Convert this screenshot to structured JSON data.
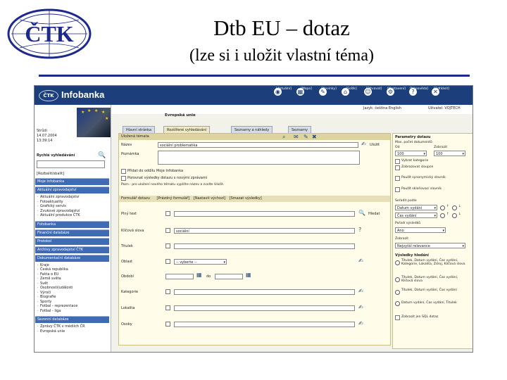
{
  "slide": {
    "logo": "ČTK",
    "title": "Dtb EU –  dotaz",
    "subtitle": "(lze si i uložit vlastní téma)"
  },
  "app": {
    "logo": "ČTK",
    "title": "Infobanka",
    "nav": [
      "[Aktuální]",
      "[Mapa]",
      "[Novinky]",
      "[Sošík]",
      "[Dítvavat]",
      "[Nastavení]",
      "[Nápověda]",
      "[Odhlásit]"
    ]
  },
  "left": {
    "info": [
      "Strůdi",
      "14.07.2004",
      "13:39:14"
    ],
    "quick_search_label": "Rychlé vyhledávání",
    "expand_label": "[Rozbalit/sbalit]",
    "menu": [
      {
        "title": "Moje Infobanka",
        "items": []
      },
      {
        "title": "Aktuální zpravodajství",
        "items": [
          "Aktuální zpravodajství",
          "Fotoaktuality",
          "Grafický servis",
          "Zvukové zpravodajství",
          "Aktuální produkce ČTK"
        ]
      },
      {
        "title": "Fotobanka",
        "items": []
      },
      {
        "title": "Finanční databáze",
        "items": []
      },
      {
        "title": "Protokol",
        "items": []
      },
      {
        "title": "Archivy zpravodajství ČTK",
        "items": []
      },
      {
        "title": "Dokumentační databáze",
        "items": [
          "Kraje",
          "Česká republika",
          "Fakta o EU",
          "Země světa",
          "Svět",
          "Osobnosti/události",
          "Výročí",
          "Biografie",
          "Sporty",
          "Fotbal - reprezentace",
          "Fotbal - liga"
        ]
      },
      {
        "title": "Sezonní databáze",
        "items": [
          "Zprávy ČTK v médiích ČR",
          "Evropská unie"
        ]
      }
    ]
  },
  "main": {
    "lang": "Jazyk: čeština   English",
    "user": "Uživatel: VOJTECH",
    "eu_title": "Evropská unie",
    "tabs": [
      "Hlavní stránka",
      "Rozšířené vyhledávání",
      "Seznamy a náhledy",
      "Seznamy"
    ],
    "query_title": "Uložená témata",
    "rows": {
      "nazev_label": "Název",
      "nazev_value": "sociální problematika",
      "save_label": "Uložit",
      "poznamka_label": "Poznámka",
      "checkbox1": "Přidat do oddílu Moje Infobanka",
      "checkbox2": "Porovnat výsledky dotazu s novými zprávami",
      "note": "Pozn.: pro uložení nového tématu vyplňte název a zvolte Uložit.",
      "section_label": "Formulář dotazu",
      "link_reset": "[Prázdný formulář]",
      "link_prev": "[Nastavit výchozí]",
      "link_hide": "[Smazat výsledky]",
      "plny_text": "Plný text",
      "klic_slova": "Klíčová slova",
      "klic_value": "sociální",
      "titulek": "Titulek",
      "oblast": "Oblast",
      "oblast_value": "-- vyberte --",
      "obdobi": "Období",
      "obdobi_do": "do",
      "kategorie": "Kategorie",
      "lokalita": "Lokalita",
      "osoby": "Osoby",
      "hledat": "Hledat"
    }
  },
  "right": {
    "title": "Parametry dotazu",
    "sub": "Max. počet dokumentů",
    "from_label": "Od",
    "from_val": "100",
    "to_label": "Zobrazit",
    "to_val": "100",
    "opts": [
      "Vybrat kategorie",
      "Zobrazovat sloupce",
      "Použít synonymický slovník",
      "Použít skloňovací slovník"
    ],
    "sort_label": "Seřadit podle",
    "sort1": "Datum vydání",
    "sort2": "Čas vydání",
    "query_rank": "Pořadí výsledků",
    "rank_val": "Ano",
    "display_label": "Zobrazit",
    "display_val": "Nejvyšší relevance",
    "results_label": "Výsledky hledání",
    "r1": "Titulek, Datum vydání, Čas vydání, Kategorie, Lokalita, Zdroj, Klíčová slova",
    "r2": "Titulek, Datum vydání, Čas vydání, Klíčová slova",
    "r3": "Titulek, Datum vydání, Čas vydání",
    "r4": "Datum vydání, Čas vydání, Titulek",
    "sql_label": "Zobrazit jen SQL dotaz"
  }
}
